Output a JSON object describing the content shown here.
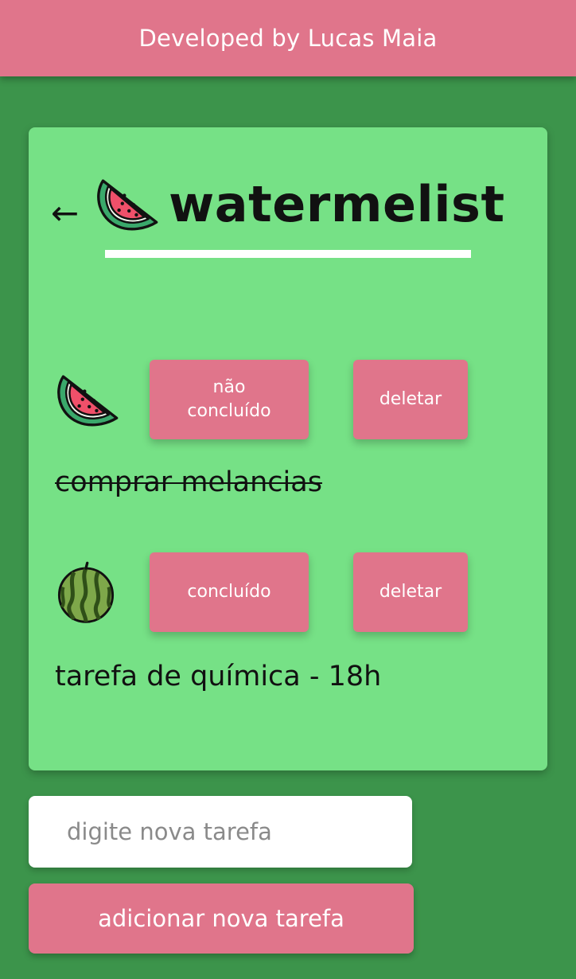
{
  "header": {
    "title": "Developed by Lucas Maia"
  },
  "app": {
    "back_icon": "left-arrow-icon",
    "logo_icon": "watermelon-slice-icon",
    "title": "watermelist"
  },
  "tasks": [
    {
      "text": "comprar melancias",
      "completed": true,
      "icon": "watermelon-slice-icon",
      "toggle_label": "não concluído",
      "delete_label": "deletar"
    },
    {
      "text": "tarefa de química - 18h",
      "completed": false,
      "icon": "whole-watermelon-icon",
      "toggle_label": "concluído",
      "delete_label": "deletar"
    }
  ],
  "new_task": {
    "placeholder": "digite nova tarefa",
    "value": "",
    "add_label": "adicionar nova tarefa"
  },
  "colors": {
    "background": "#3c944b",
    "card": "#76e186",
    "accent_pink": "#e0758b",
    "text_dark": "#111111"
  }
}
